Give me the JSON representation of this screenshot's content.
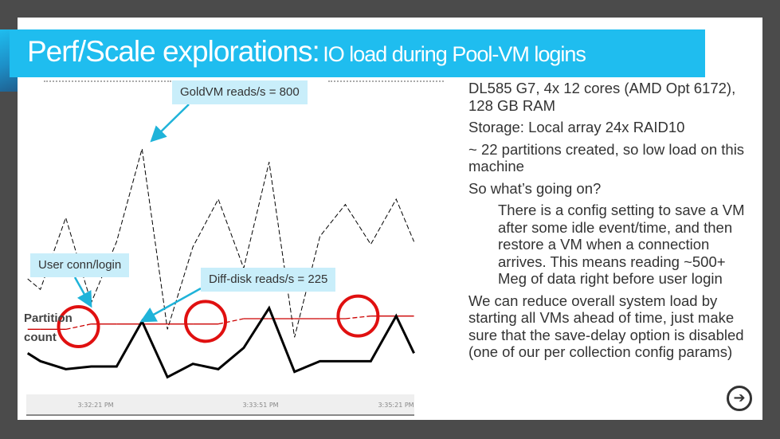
{
  "slide": {
    "title_main": "Perf/Scale explorations:",
    "title_sub": "IO load during Pool-VM logins",
    "accent_color": "#1fbdef"
  },
  "callouts": {
    "gold": "GoldVM reads/s = 800",
    "user": "User conn/login",
    "diff": "Diff-disk reads/s = 225"
  },
  "partition_label": [
    "Partition",
    "count"
  ],
  "chart_data": {
    "type": "line",
    "x_ticks": [
      "3:32:21 PM",
      "3:33:51 PM",
      "3:35:21 PM"
    ],
    "x": [
      -0.5,
      0,
      1,
      2,
      3,
      4,
      5,
      6,
      7,
      8,
      9,
      10,
      11,
      12,
      13,
      14,
      14.7
    ],
    "series": [
      {
        "name": "GoldVM reads/s",
        "style": "dashed",
        "color": "#000000",
        "values": [
          42,
          38,
          65,
          33,
          56,
          91,
          23,
          54,
          72,
          46,
          86,
          20,
          58,
          70,
          55,
          72,
          56
        ]
      },
      {
        "name": "Diff-disk reads/s",
        "style": "solid-thick",
        "color": "#000000",
        "values": [
          14,
          11,
          8,
          9,
          9,
          26,
          5,
          10,
          8,
          16,
          31,
          7,
          11,
          11,
          11,
          28,
          14
        ]
      },
      {
        "name": "Partition count",
        "style": "step",
        "color": "#cc0000",
        "values": [
          23,
          23,
          23,
          25,
          25,
          25,
          25,
          25,
          25,
          27,
          27,
          27,
          27,
          27,
          28,
          28,
          28
        ]
      }
    ],
    "highlight_circles_at_x": [
      1.5,
      6.5,
      12.5
    ],
    "highlight_color": "#e01010",
    "grid": false
  },
  "bullets": [
    {
      "text": "DL585 G7, 4x 12 cores (AMD Opt 6172), 128 GB RAM",
      "indent": false
    },
    {
      "text": "Storage: Local array 24x RAID10",
      "indent": false
    },
    {
      "text": "~ 22 partitions created, so low load on this machine",
      "indent": false
    },
    {
      "text": "So what’s going on?",
      "indent": false
    },
    {
      "text": "There is a config setting to save a VM after some idle event/time, and then restore a VM when a connection arrives. This means reading ~500+ Meg of data right before user login",
      "indent": true
    },
    {
      "text": "We can reduce overall system load by starting all VMs ahead of time, just make sure that the save-delay option is disabled (one of our per collection config params)",
      "indent": false
    }
  ],
  "next_icon": "arrow-right-circle-icon",
  "next_glyph": "➔"
}
